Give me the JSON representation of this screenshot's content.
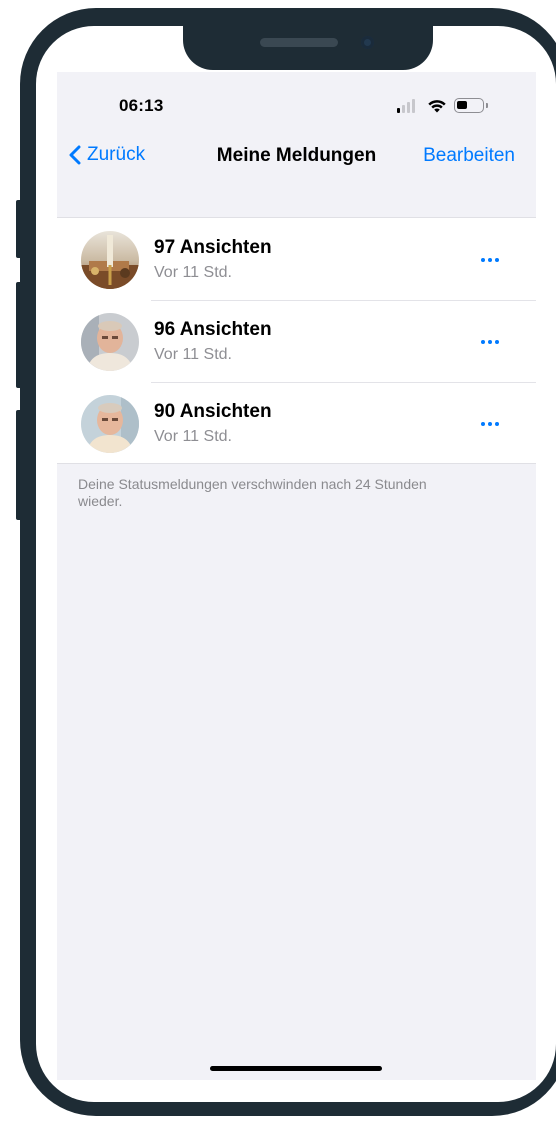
{
  "status_bar": {
    "time": "06:13"
  },
  "nav": {
    "back_label": "Zurück",
    "title": "Meine Meldungen",
    "edit_label": "Bearbeiten"
  },
  "updates": [
    {
      "views": "97 Ansichten",
      "time_ago": "Vor 11 Std."
    },
    {
      "views": "96 Ansichten",
      "time_ago": "Vor 11 Std."
    },
    {
      "views": "90 Ansichten",
      "time_ago": "Vor 11 Std."
    }
  ],
  "footer_note": "Deine Statusmeldungen verschwinden nach 24 Stunden wieder.",
  "colors": {
    "accent": "#007aff",
    "background": "#f2f2f7",
    "frame": "#1e2c35"
  }
}
